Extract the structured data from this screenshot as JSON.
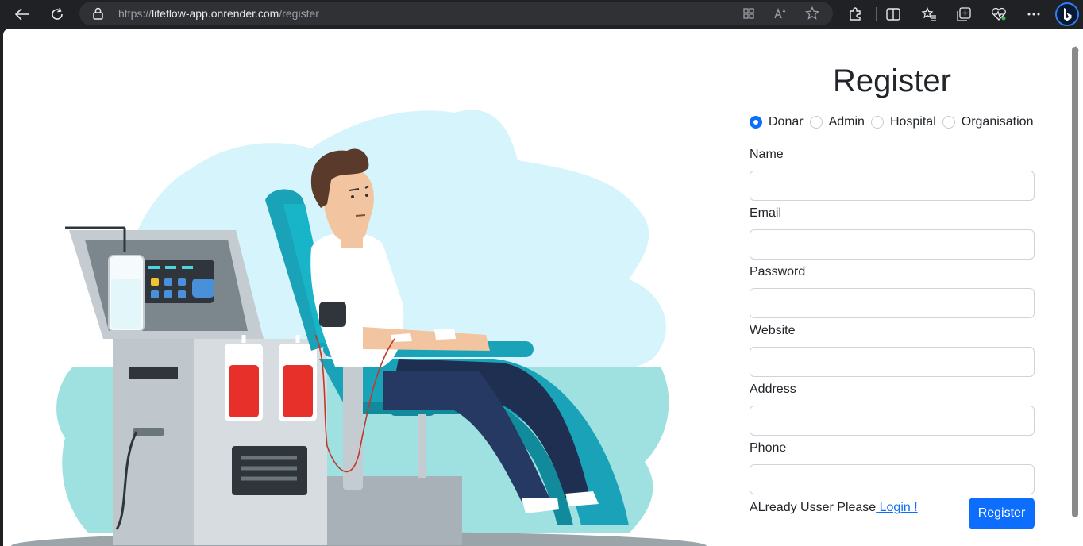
{
  "browser": {
    "url_scheme": "https://",
    "url_host": "lifeflow-app.onrender.com",
    "url_path": "/register",
    "icons": [
      "back-icon",
      "refresh-icon",
      "lock-icon",
      "app-available-icon",
      "read-aloud-icon",
      "favorite-star-icon",
      "extensions-icon",
      "split-screen-icon",
      "favorites-icon",
      "collections-icon",
      "browser-essentials-icon",
      "more-icon",
      "copilot-icon"
    ]
  },
  "form": {
    "title": "Register",
    "roles": [
      {
        "label": "Donar",
        "checked": true
      },
      {
        "label": "Admin",
        "checked": false
      },
      {
        "label": "Hospital",
        "checked": false
      },
      {
        "label": "Organisation",
        "checked": false
      }
    ],
    "fields": [
      {
        "label": "Name",
        "value": ""
      },
      {
        "label": "Email",
        "value": ""
      },
      {
        "label": "Password",
        "value": ""
      },
      {
        "label": "Website",
        "value": ""
      },
      {
        "label": "Address",
        "value": ""
      },
      {
        "label": "Phone",
        "value": ""
      }
    ],
    "login_prompt": "ALready Usser Please",
    "login_link": " Login !",
    "submit_label": "Register"
  },
  "colors": {
    "accent": "#0d6efd",
    "chrome": "#202124",
    "illustration_bg": "#d5f4fb",
    "chair": "#1aa3b8",
    "blood": "#e8302b"
  }
}
